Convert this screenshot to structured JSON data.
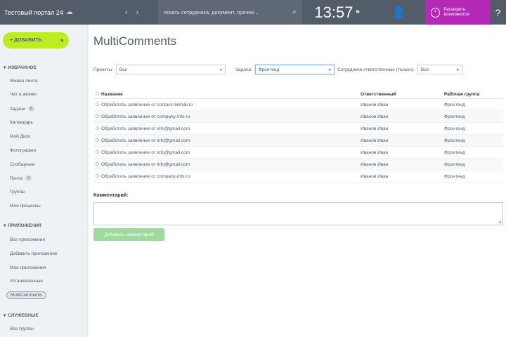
{
  "topbar": {
    "portal_name": "Тестовый портал 24",
    "b24_badge": "24",
    "cloud_icon": "cloud-icon",
    "back_icon": "back-arrow-icon",
    "forward_icon": "forward-arrow-icon",
    "search_placeholder": "искать сотрудника, документ, прочее...",
    "time": "13:57",
    "flag_icon": "flag-icon",
    "user_icon": "user-icon",
    "promo_text": "Расширить возможности",
    "help_icon": "help-icon"
  },
  "sidebar": {
    "create_label": "+ ДОБАВИТЬ",
    "sections": [
      {
        "label": "ИЗБРАННОЕ",
        "items": [
          {
            "label": "Живая лента"
          },
          {
            "label": "Чат и звонки"
          },
          {
            "label": "Задачи",
            "badge": "6"
          },
          {
            "label": "Календарь"
          },
          {
            "label": "Мой Диск"
          },
          {
            "label": "Фотографии"
          },
          {
            "label": "Сообщения"
          },
          {
            "label": "Почта",
            "badge": "0"
          },
          {
            "label": "Группы"
          },
          {
            "label": "Мои процессы"
          }
        ]
      },
      {
        "label": "ПРИЛОЖЕНИЯ",
        "items": [
          {
            "label": "Все приложения"
          },
          {
            "label": "Добавить приложение"
          },
          {
            "label": "Мои приложения"
          },
          {
            "label": "Установленные"
          },
          {
            "label": "MultiComments",
            "active": true
          }
        ]
      },
      {
        "label": "СЛУЖЕБНЫЕ",
        "items": [
          {
            "label": "Все группы"
          }
        ]
      }
    ]
  },
  "main": {
    "title": "MultiComments",
    "filters": {
      "label1": "Проекты:",
      "value1": "Все",
      "label2": "Задача:",
      "value2": "Фронтенд",
      "label3": "Сотрудники ответственные (только):",
      "value3": "Все"
    },
    "table": {
      "headers": [
        "Название",
        "Ответственный",
        "Рабочая группа"
      ],
      "rows": [
        [
          "Обработать заявление от contact-mikhail.ru",
          "Иванов Иван",
          "Фронтенд"
        ],
        [
          "Обработать заявление от company-info.ru",
          "Иванов Иван",
          "Фронтенд"
        ],
        [
          "Обработать заявление от info@gmail.com",
          "Иванов Иван",
          "Фронтенд"
        ],
        [
          "Обработать заявление от info@gmail.com",
          "Иванов Иван",
          "Фронтенд"
        ],
        [
          "Обработать заявление от info@gmail.com",
          "Иванов Иван",
          "Фронтенд"
        ],
        [
          "Обработать заявление от info@gmail.com",
          "Иванов Иван",
          "Фронтенд"
        ],
        [
          "Обработать заявление от company-info.ru",
          "Иванов Иван",
          "Фронтенд"
        ]
      ]
    },
    "comment_label": "Комментарий:",
    "comment_value": "",
    "add_button": "Добавить комментарий"
  }
}
